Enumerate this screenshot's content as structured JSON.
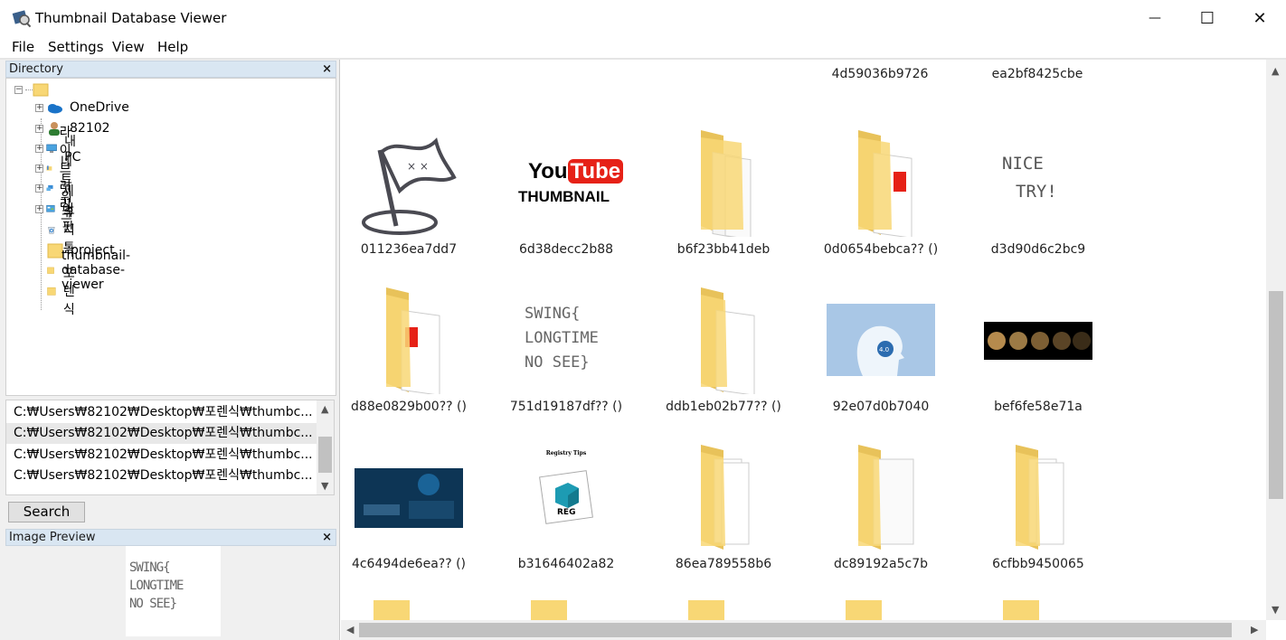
{
  "window": {
    "title": "Thumbnail Database Viewer",
    "minimize_glyph": "—",
    "maximize_glyph": "☐",
    "close_glyph": "✕"
  },
  "menu": [
    "File",
    "Settings",
    "View",
    "Help"
  ],
  "directory": {
    "header": "Directory",
    "close": "×",
    "tree": [
      {
        "label": "OneDrive",
        "icon": "onedrive-icon"
      },
      {
        "label": "82102",
        "icon": "user-icon"
      },
      {
        "label": "내 PC",
        "icon": "pc-icon"
      },
      {
        "label": "라이브러리",
        "icon": "library-icon"
      },
      {
        "label": "네트워크",
        "icon": "network-icon"
      },
      {
        "label": "제어판",
        "icon": "control-panel-icon"
      },
      {
        "label": "휴지통",
        "icon": "recycle-bin-icon"
      },
      {
        "label": "project",
        "icon": "folder-icon"
      },
      {
        "label": "thumbnail-database-viewer",
        "icon": "folder-icon"
      },
      {
        "label": "포렌식",
        "icon": "folder-icon"
      }
    ]
  },
  "paths": [
    "C:₩Users₩82102₩Desktop₩포렌식₩thumbc...",
    "C:₩Users₩82102₩Desktop₩포렌식₩thumbc...",
    "C:₩Users₩82102₩Desktop₩포렌식₩thumbc...",
    "C:₩Users₩82102₩Desktop₩포렌식₩thumbc..."
  ],
  "search_label": "Search",
  "preview": {
    "header": "Image Preview",
    "close": "×",
    "lines": [
      "SWING{",
      "LONGTIME",
      "NO SEE}"
    ]
  },
  "thumbnails_top": [
    "4d59036b9726",
    "ea2bf8425cbe"
  ],
  "thumbnails": [
    {
      "name": "011236ea7dd7",
      "kind": "flag"
    },
    {
      "name": "6d38decc2b88",
      "kind": "youtube"
    },
    {
      "name": "b6f23bb41deb",
      "kind": "folder-docs"
    },
    {
      "name": "0d0654bebca?? ()",
      "kind": "folder-youtube"
    },
    {
      "name": "d3d90d6c2bc9",
      "kind": "nice-try"
    },
    {
      "name": "d88e0829b00?? ()",
      "kind": "folder-youtube"
    },
    {
      "name": "751d19187df?? ()",
      "kind": "swing"
    },
    {
      "name": "ddb1eb02b77?? ()",
      "kind": "folder-docs"
    },
    {
      "name": "92e07d0b7040",
      "kind": "blue-head"
    },
    {
      "name": "bef6fe58e71a",
      "kind": "moons"
    },
    {
      "name": "4c6494de6ea?? ()",
      "kind": "dark-slide"
    },
    {
      "name": "b31646402a82",
      "kind": "reg"
    },
    {
      "name": "86ea789558b6",
      "kind": "folder-full"
    },
    {
      "name": "dc89192a5c7b",
      "kind": "folder-blank"
    },
    {
      "name": "6cfbb9450065",
      "kind": "folder-full"
    }
  ],
  "youtube": {
    "you": "You",
    "tube": "Tube",
    "caption": "THUMBNAIL"
  },
  "nice_try": [
    "NICE",
    "TRY!"
  ],
  "reg_text": {
    "top": "Registry Tips",
    "label": "REG"
  },
  "blue_head_badge": "4.0"
}
